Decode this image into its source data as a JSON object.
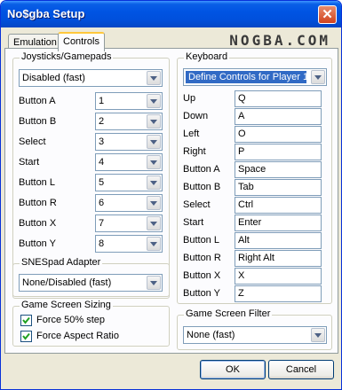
{
  "window": {
    "title": "No$gba Setup",
    "close_symbol": "✕",
    "logo": "NOGBA.COM"
  },
  "tabs": [
    {
      "label": "Emulation",
      "active": false
    },
    {
      "label": "Controls",
      "active": true
    }
  ],
  "joysticks": {
    "title": "Joysticks/Gamepads",
    "device": "Disabled (fast)",
    "buttons": [
      {
        "label": "Button A",
        "value": "1"
      },
      {
        "label": "Button B",
        "value": "2"
      },
      {
        "label": "Select",
        "value": "3"
      },
      {
        "label": "Start",
        "value": "4"
      },
      {
        "label": "Button L",
        "value": "5"
      },
      {
        "label": "Button R",
        "value": "6"
      },
      {
        "label": "Button X",
        "value": "7"
      },
      {
        "label": "Button Y",
        "value": "8"
      }
    ]
  },
  "snespad": {
    "title": "SNESpad Adapter",
    "value": "None/Disabled (fast)"
  },
  "sizing": {
    "title": "Game Screen Sizing",
    "options": [
      {
        "label": "Force 50% step",
        "checked": true
      },
      {
        "label": "Force Aspect Ratio",
        "checked": true
      }
    ]
  },
  "keyboard": {
    "title": "Keyboard",
    "player": "Define Controls for Player 1",
    "keys": [
      {
        "label": "Up",
        "value": "Q"
      },
      {
        "label": "Down",
        "value": "A"
      },
      {
        "label": "Left",
        "value": "O"
      },
      {
        "label": "Right",
        "value": "P"
      },
      {
        "label": "Button A",
        "value": "Space"
      },
      {
        "label": "Button B",
        "value": "Tab"
      },
      {
        "label": "Select",
        "value": "Ctrl"
      },
      {
        "label": "Start",
        "value": "Enter"
      },
      {
        "label": "Button L",
        "value": "Alt"
      },
      {
        "label": "Button R",
        "value": "Right Alt"
      },
      {
        "label": "Button X",
        "value": "X"
      },
      {
        "label": "Button Y",
        "value": "Z"
      }
    ]
  },
  "filter": {
    "title": "Game Screen Filter",
    "value": "None (fast)"
  },
  "buttons": {
    "ok": "OK",
    "cancel": "Cancel"
  }
}
